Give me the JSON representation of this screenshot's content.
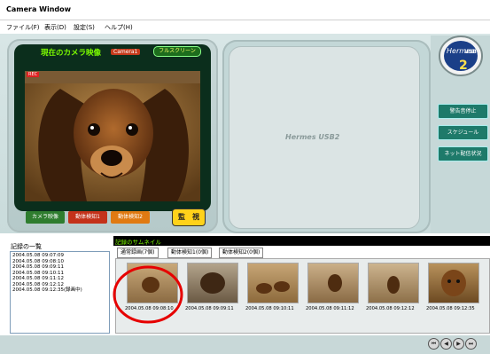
{
  "window": {
    "title": "Camera Window"
  },
  "menu": [
    {
      "label": "ファイル(F)"
    },
    {
      "label": "表示(D)"
    },
    {
      "label": "設定(S)"
    },
    {
      "label": "ヘルプ(H)"
    }
  ],
  "camera_panel": {
    "title": "現在のカメラ映像",
    "camera_name": "Camera1",
    "fullscreen_label": "フルスクリーン",
    "rec_badge": "REC",
    "buttons": [
      {
        "label": "カメラ映像",
        "color": "#2f7d2f"
      },
      {
        "label": "動体検知1",
        "color": "#c4321a"
      },
      {
        "label": "動体検知2",
        "color": "#e07a12"
      }
    ],
    "monitor_label": "監　視"
  },
  "center_logo": "Hermes USB2",
  "brand": {
    "line1": "Hermes",
    "line2": "USB",
    "num": "2"
  },
  "side_buttons": [
    {
      "label": "警告音停止"
    },
    {
      "label": "スケジュール"
    },
    {
      "label": "ネット配信状況"
    }
  ],
  "records": {
    "label": "記録の一覧",
    "items": [
      "2004.05.08 09:07:09",
      "2004.05.08 09:08:10",
      "2004.05.08 09:09:11",
      "2004.05.08 09:10:11",
      "2004.05.08 09:11:12",
      "2004.05.08 09:12:12",
      "2004.05.08 09:12:35(録画中)"
    ]
  },
  "thumbs": {
    "header": "記録のサムネイル",
    "tabs": [
      {
        "label": "通常録画(7個)"
      },
      {
        "label": "動体検知1(0個)"
      },
      {
        "label": "動体検知2(0個)"
      }
    ],
    "items": [
      {
        "caption": "2004.05.08 09:08:10"
      },
      {
        "caption": "2004.05.08 09:09:11"
      },
      {
        "caption": "2004.05.08 09:10:11"
      },
      {
        "caption": "2004.05.08 09:11:12"
      },
      {
        "caption": "2004.05.08 09:12:12"
      },
      {
        "caption": "2004.05.08 09:12:35"
      }
    ]
  },
  "nav": [
    {
      "symbol": "⏮"
    },
    {
      "symbol": "◀"
    },
    {
      "symbol": "▶"
    },
    {
      "symbol": "⏭"
    }
  ]
}
